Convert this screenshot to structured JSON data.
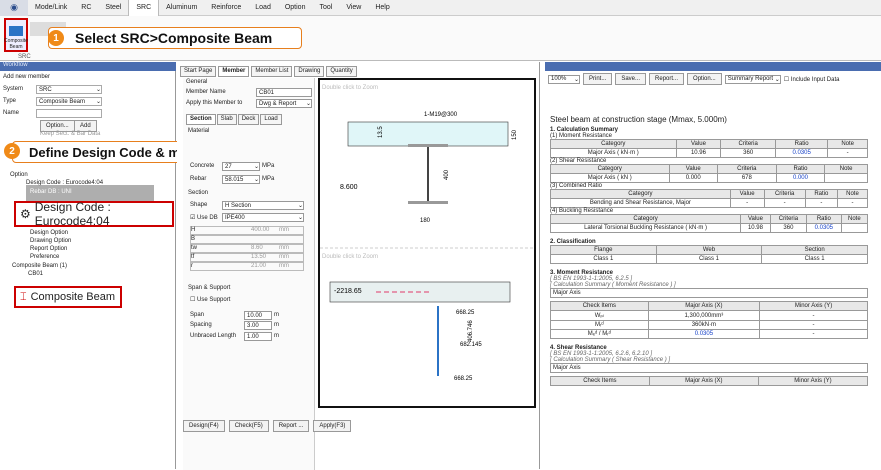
{
  "menu": [
    "Mode/Link",
    "RC",
    "Steel",
    "SRC",
    "Aluminum",
    "Reinforce",
    "Load",
    "Option",
    "Tool",
    "View",
    "Help"
  ],
  "ribbon": {
    "btn": "Composite Beam",
    "group": "SRC"
  },
  "callout1": {
    "num": "1",
    "text": "Select SRC>Composite Beam"
  },
  "callout2": {
    "num": "2",
    "text": "Define Design Code & module"
  },
  "left": {
    "title": "Workflow",
    "add": "Add new member",
    "system_lbl": "System",
    "system": "SRC",
    "type_lbl": "Type",
    "type": "Composite Beam",
    "name_lbl": "Name",
    "option_btn": "Option...",
    "add_btn": "Add",
    "keep": "Keep Sect. & Bar Data"
  },
  "tree": {
    "option": "Option",
    "dc_small": "Design Code : Eurocode4:04",
    "rebar": "Rebar DB : UNI",
    "dc_big": "Design Code : Eurocode4:04",
    "design_opt": "Design Option",
    "drawing_opt": "Drawing Option",
    "report_opt": "Report Option",
    "pref": "Preference",
    "comp": "Composite Beam (1)",
    "cb01": "CB01",
    "comp_big": "Composite Beam"
  },
  "tabs": [
    "Start Page",
    "Member",
    "Member List",
    "Drawing",
    "Quantity"
  ],
  "form": {
    "general": "General",
    "member_name_lbl": "Member Name",
    "member_name": "CB01",
    "apply_lbl": "Apply this Member to",
    "apply": "Dwg & Report",
    "subtabs": [
      "Section",
      "Slab",
      "Deck",
      "Load"
    ],
    "material": "Material",
    "concrete_lbl": "Concrete",
    "concrete": "27",
    "mpa": "MPa",
    "rebar_lbl": "Rebar",
    "rebar": "58.015",
    "section": "Section",
    "shape_lbl": "Shape",
    "shape": "H Section",
    "usedb": "Use DB",
    "db": "IPE400",
    "rows": [
      {
        "k": "H",
        "v": "400.00",
        "u": "mm"
      },
      {
        "k": "B",
        "v": "",
        "u": ""
      },
      {
        "k": "tw",
        "v": "8.60",
        "u": "mm"
      },
      {
        "k": "tf",
        "v": "13.50",
        "u": "mm"
      },
      {
        "k": "r",
        "v": "21.00",
        "u": "mm"
      }
    ],
    "span_support": "Span & Support",
    "use_support": "Use Support",
    "span_lbl": "Span",
    "span": "10.00",
    "spacing_lbl": "Spacing",
    "spacing": "3.00",
    "unbraced_lbl": "Unbraced Length",
    "unbraced": "1.00",
    "m": "m"
  },
  "buttons": [
    "Design(F4)",
    "Check(F5)",
    "Report ...",
    "Apply(F3)"
  ],
  "drawing": {
    "hint": "Double click to Zoom",
    "rebar": "1-M19@300",
    "d13": "13.5",
    "d150": "150",
    "d8": "8.600",
    "d400": "400",
    "d180": "180",
    "f1": "-2218.65",
    "f2": "668.25",
    "f3": "682.145",
    "f4": "668.25",
    "dim": "406.746"
  },
  "report": {
    "toolbar": {
      "zoom": "100%",
      "print": "Print...",
      "save": "Save...",
      "report": "Report...",
      "option": "Option...",
      "summary": "Summary Report",
      "include": "Include Input Data"
    },
    "heading": "Steel beam at construction stage (Mmax, 5.000m)",
    "s1": "1. Calculation Summary",
    "m1": "(1) Moment Resistance",
    "m2": "(2) Shear Resistance",
    "m3": "(3) Combined Ratio",
    "m4": "(4) Buckling Resistance",
    "cols": [
      "Category",
      "Value",
      "Criteria",
      "Ratio",
      "Note"
    ],
    "r1": [
      "Major Axis ( kN·m )",
      "10.96",
      "360",
      "0.0305",
      "-"
    ],
    "r2": [
      "Major Axis ( kN )",
      "0.000",
      "678",
      "0.000",
      ""
    ],
    "r3": [
      "Bending and Shear Resistance, Major",
      "-",
      "-",
      "-",
      "-"
    ],
    "r4": [
      "Lateral Torsional Buckling Resistance ( kN·m )",
      "10.98",
      "360",
      "0.0305",
      ""
    ],
    "s2": "2. Classification",
    "cls_cols": [
      "Flange",
      "Web",
      "Section"
    ],
    "cls": [
      "Class 1",
      "Class 1",
      "Class 1"
    ],
    "s3": "3. Moment Resistance",
    "s3a": "[ BS EN 1993-1-1:2005, 6.2.5 ]",
    "s3b": "[ Calculation Summary ( Moment Resistance ) ]",
    "major": "Major Axis",
    "chk_cols": [
      "Check Items",
      "Major Axis (X)",
      "Minor Axis (Y)"
    ],
    "chk": [
      [
        "Wₚₗ",
        "1,300,000mm³",
        "-"
      ],
      [
        "Mᵣᵈ",
        "360kN·m",
        "-"
      ],
      [
        "Mₑᵈ / Mᵣᵈ",
        "0.0305",
        "-"
      ]
    ],
    "s4": "4. Shear Resistance",
    "s4a": "[ BS EN 1993-1-1:2005, 6.2.6, 6.2.10 ]",
    "s4b": "[ Calculation Summary ( Shear Resistance ) ]",
    "chk2_cols": [
      "Check Items",
      "Major Axis (X)",
      "Minor Axis (Y)"
    ]
  }
}
